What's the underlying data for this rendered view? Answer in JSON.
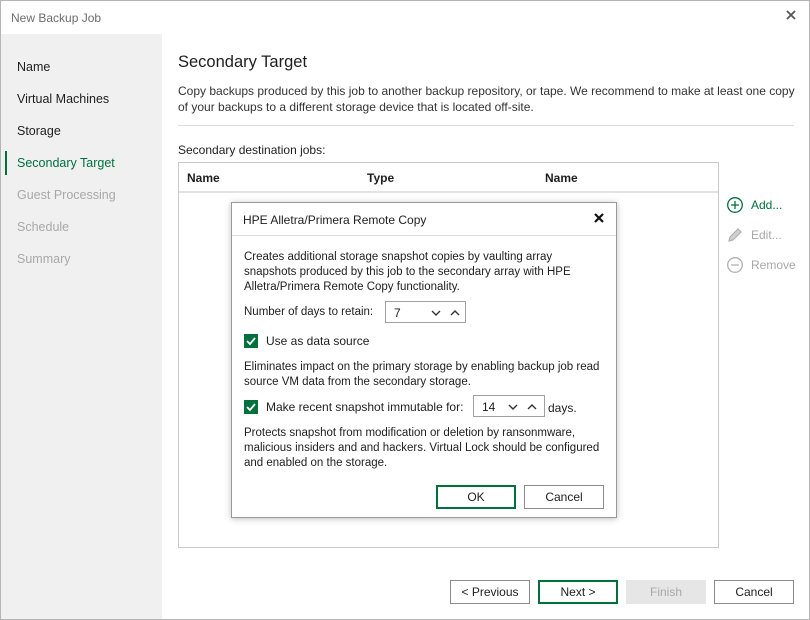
{
  "window": {
    "title": "New Backup Job"
  },
  "sidebar": {
    "items": [
      {
        "label": "Name",
        "state": "normal"
      },
      {
        "label": "Virtual Machines",
        "state": "normal"
      },
      {
        "label": "Storage",
        "state": "normal"
      },
      {
        "label": "Secondary Target",
        "state": "active"
      },
      {
        "label": "Guest Processing",
        "state": "disabled"
      },
      {
        "label": "Schedule",
        "state": "disabled"
      },
      {
        "label": "Summary",
        "state": "disabled"
      }
    ]
  },
  "main": {
    "title": "Secondary Target",
    "description": "Copy backups produced by this job to another backup repository, or tape. We recommend to make at least one copy of your backups to a different storage device that is located off-site.",
    "jobs_label": "Secondary destination jobs:",
    "columns": [
      "Name",
      "Type",
      "Name"
    ],
    "actions": {
      "add": "Add...",
      "edit": "Edit...",
      "remove": "Remove"
    }
  },
  "dialog": {
    "title": "HPE Alletra/Primera Remote Copy",
    "intro": "Creates additional storage snapshot copies by vaulting array snapshots produced by this job to the secondary array with HPE Alletra/Primera Remote Copy functionality.",
    "retain_label": "Number of days to retain:",
    "retain_value": "7",
    "use_source_label": "Use as data source",
    "use_source_checked": true,
    "use_source_desc": "Eliminates impact on the primary storage by enabling backup job read source VM data from the secondary storage.",
    "immutable_label": "Make recent snapshot immutable for:",
    "immutable_checked": true,
    "immutable_value": "14",
    "immutable_unit": "days.",
    "immutable_desc": "Protects snapshot from modification or deletion by ransonmware, malicious insiders and and hackers. Virtual Lock should be configured and enabled on the storage.",
    "ok_label": "OK",
    "cancel_label": "Cancel"
  },
  "footer": {
    "previous": "< Previous",
    "next": "Next >",
    "finish": "Finish",
    "cancel": "Cancel"
  },
  "colors": {
    "accent": "#00703c",
    "disabled_text": "#a8a8a8",
    "sidebar_bg": "#f0f0f0"
  }
}
